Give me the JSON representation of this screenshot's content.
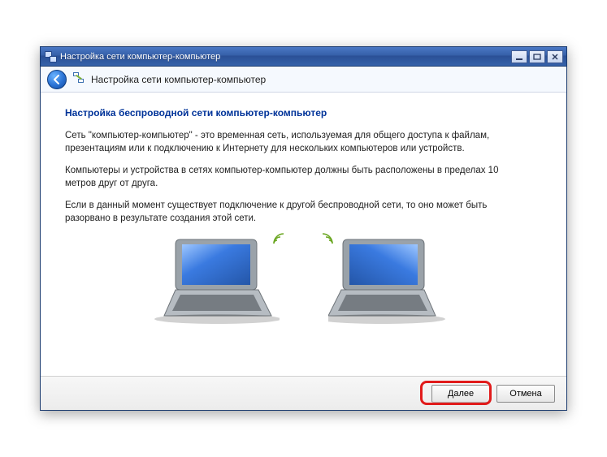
{
  "window": {
    "title": "Настройка сети компьютер-компьютер"
  },
  "nav": {
    "title": "Настройка сети компьютер-компьютер"
  },
  "content": {
    "heading": "Настройка беспроводной сети компьютер-компьютер",
    "para1": "Сеть \"компьютер-компьютер\" - это временная сеть, используемая для общего доступа к файлам, презентациям или к подключению к Интернету для нескольких компьютеров или устройств.",
    "para2": "Компьютеры и устройства в сетях компьютер-компьютер должны быть расположены в пределах 10 метров друг от друга.",
    "para3": "Если в данный момент существует подключение к другой беспроводной сети, то оно может быть разорвано в результате создания этой сети."
  },
  "footer": {
    "next_label": "Далее",
    "cancel_label": "Отмена"
  },
  "icons": {
    "back": "back-arrow-icon",
    "network": "network-pc-icon",
    "minimize": "minimize-icon",
    "maximize": "maximize-icon",
    "close": "close-icon",
    "wifi_signal": "wifi-signal-icon",
    "laptop": "laptop-icon"
  }
}
